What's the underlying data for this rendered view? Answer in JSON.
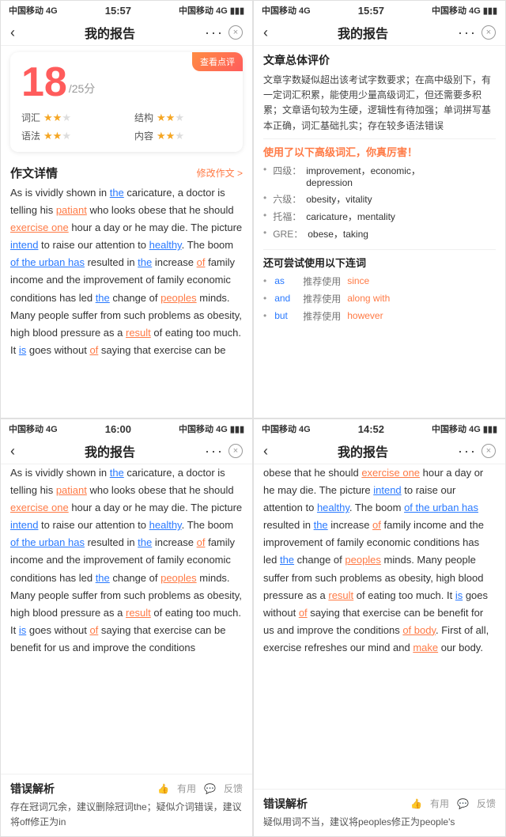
{
  "panels": [
    {
      "id": "panel-top-left",
      "status": {
        "carrier": "中国移动",
        "network": "4G",
        "time": "15:57",
        "carrier2": "中国移动",
        "network2": "4G"
      },
      "nav": {
        "title": "我的报告",
        "back": "<",
        "dots": "...",
        "close": "×"
      },
      "score": {
        "review_btn": "查看点评",
        "number": "18",
        "total": "/25分",
        "dims": [
          {
            "label": "词汇",
            "stars": 2,
            "max": 3
          },
          {
            "label": "结构",
            "stars": 2,
            "max": 3
          },
          {
            "label": "语法",
            "stars": 2,
            "max": 3
          },
          {
            "label": "内容",
            "stars": 2,
            "max": 3
          }
        ]
      },
      "section": {
        "title": "作文详情",
        "action": "修改作文 >"
      },
      "essay_segments": [
        {
          "text": "As is vividly shown in ",
          "type": "normal"
        },
        {
          "text": "the",
          "type": "blue"
        },
        {
          "text": " caricature, a doctor is telling his ",
          "type": "normal"
        },
        {
          "text": "patiant",
          "type": "orange"
        },
        {
          "text": " who looks obese that he should ",
          "type": "normal"
        },
        {
          "text": "exercise one",
          "type": "orange-underline"
        },
        {
          "text": " hour a day or he may die. The picture ",
          "type": "normal"
        },
        {
          "text": "intend",
          "type": "blue"
        },
        {
          "text": " to raise our attention to ",
          "type": "normal"
        },
        {
          "text": "healthy",
          "type": "blue"
        },
        {
          "text": ". The boom ",
          "type": "normal"
        },
        {
          "text": "of the urban has",
          "type": "blue"
        },
        {
          "text": " resulted in ",
          "type": "normal"
        },
        {
          "text": "the",
          "type": "blue"
        },
        {
          "text": " increase ",
          "type": "normal"
        },
        {
          "text": "of",
          "type": "orange"
        },
        {
          "text": " family income and the improvement of family economic conditions has led ",
          "type": "normal"
        },
        {
          "text": "the",
          "type": "blue"
        },
        {
          "text": " change of ",
          "type": "normal"
        },
        {
          "text": "peoples",
          "type": "orange"
        },
        {
          "text": " minds. Many people suffer from such problems as obesity, high blood pressure as a ",
          "type": "normal"
        },
        {
          "text": "result",
          "type": "orange"
        },
        {
          "text": " of eating too much. It ",
          "type": "normal"
        },
        {
          "text": "is",
          "type": "blue"
        },
        {
          "text": " goes without ",
          "type": "normal"
        },
        {
          "text": "of",
          "type": "orange"
        },
        {
          "text": " saying that exercise can be",
          "type": "normal"
        }
      ]
    },
    {
      "id": "panel-top-right",
      "status": {
        "carrier": "中国移动",
        "network": "4G",
        "time": "15:57",
        "carrier2": "中国移动",
        "network2": "4G"
      },
      "nav": {
        "title": "我的报告",
        "back": "<",
        "dots": "...",
        "close": "×"
      },
      "overall": {
        "title": "文章总体评价",
        "text": "文章字数疑似超出该考试字数要求；在高中级别下，有一定词汇积累，能使用少量高级词汇，但还需要多积累；文章语句较为生硬，逻辑性有待加强；单词拼写基本正确，词汇基础扎实；存在较多语法错误"
      },
      "vocab": {
        "title": "使用了以下高级词汇，你真厉害！",
        "items": [
          {
            "level": "四级：",
            "words": "improvement，economic，depression"
          },
          {
            "level": "六级：",
            "words": "obesity，vitality"
          },
          {
            "level": "托福：",
            "words": "caricature，mentality"
          },
          {
            "level": "GRE：",
            "words": "obese，taking"
          }
        ]
      },
      "connectors": {
        "title": "还可尝试使用以下连词",
        "items": [
          {
            "word": "as",
            "label": "推荐使用",
            "suggest": "since"
          },
          {
            "word": "and",
            "label": "推荐使用",
            "suggest": "along with"
          },
          {
            "word": "but",
            "label": "推荐使用",
            "suggest": "however"
          }
        ]
      }
    },
    {
      "id": "panel-bottom-left",
      "status": {
        "carrier": "中国移动",
        "network": "4G",
        "time": "16:00"
      },
      "nav": {
        "title": "我的报告",
        "back": "<",
        "dots": "...",
        "close": "×"
      },
      "essay_segments": [
        {
          "text": "As is vividly shown in ",
          "type": "normal"
        },
        {
          "text": "the",
          "type": "blue"
        },
        {
          "text": " caricature, a doctor is telling his ",
          "type": "normal"
        },
        {
          "text": "patiant",
          "type": "orange"
        },
        {
          "text": " who looks obese that he should ",
          "type": "normal"
        },
        {
          "text": "exercise one",
          "type": "orange-underline"
        },
        {
          "text": " hour a day or he may die. The picture ",
          "type": "normal"
        },
        {
          "text": "intend",
          "type": "blue"
        },
        {
          "text": " to raise our attention to ",
          "type": "normal"
        },
        {
          "text": "healthy",
          "type": "blue"
        },
        {
          "text": ". The boom ",
          "type": "normal"
        },
        {
          "text": "of the urban has",
          "type": "blue"
        },
        {
          "text": " resulted in ",
          "type": "normal"
        },
        {
          "text": "the",
          "type": "blue"
        },
        {
          "text": " increase ",
          "type": "normal"
        },
        {
          "text": "of",
          "type": "orange"
        },
        {
          "text": " family income and the improvement of family economic conditions has led ",
          "type": "normal"
        },
        {
          "text": "the",
          "type": "blue"
        },
        {
          "text": " change of ",
          "type": "normal"
        },
        {
          "text": "peoples",
          "type": "orange"
        },
        {
          "text": " minds. Many people suffer from such problems as obesity, high blood pressure as a ",
          "type": "normal"
        },
        {
          "text": "result",
          "type": "orange"
        },
        {
          "text": " of eating too much. It ",
          "type": "normal"
        },
        {
          "text": "is",
          "type": "blue"
        },
        {
          "text": " goes without ",
          "type": "normal"
        },
        {
          "text": "of",
          "type": "orange"
        },
        {
          "text": " saying that exercise can be benefit for us and improve the conditions",
          "type": "normal"
        }
      ],
      "error": {
        "title": "错误解析",
        "helpful": "有用",
        "feedback": "反馈",
        "text": "存在冠词冗余，建议删除冠词the；疑似介词错误，建议将off修正为in"
      }
    },
    {
      "id": "panel-bottom-right",
      "status": {
        "carrier": "中国移动",
        "network": "4G",
        "time": "14:52"
      },
      "nav": {
        "title": "我的报告",
        "back": "<",
        "dots": "...",
        "close": "×"
      },
      "essay_segments": [
        {
          "text": "obese that he should ",
          "type": "normal"
        },
        {
          "text": "exercise one",
          "type": "orange-underline"
        },
        {
          "text": " hour a day or he may die. The picture ",
          "type": "normal"
        },
        {
          "text": "intend",
          "type": "blue"
        },
        {
          "text": " to raise our attention to ",
          "type": "normal"
        },
        {
          "text": "healthy",
          "type": "blue"
        },
        {
          "text": ". The boom ",
          "type": "normal"
        },
        {
          "text": "of the urban has",
          "type": "blue"
        },
        {
          "text": " resulted in ",
          "type": "normal"
        },
        {
          "text": "the",
          "type": "blue"
        },
        {
          "text": " increase ",
          "type": "normal"
        },
        {
          "text": "of",
          "type": "orange"
        },
        {
          "text": " family income and the improvement of family economic conditions has led ",
          "type": "normal"
        },
        {
          "text": "the",
          "type": "blue"
        },
        {
          "text": " change of ",
          "type": "normal"
        },
        {
          "text": "peoples",
          "type": "orange"
        },
        {
          "text": " minds. Many people suffer from such problems as obesity, high blood pressure as a ",
          "type": "normal"
        },
        {
          "text": "result",
          "type": "orange"
        },
        {
          "text": " of eating too much. It ",
          "type": "normal"
        },
        {
          "text": "is",
          "type": "blue"
        },
        {
          "text": " goes without ",
          "type": "normal"
        },
        {
          "text": "of",
          "type": "orange"
        },
        {
          "text": " saying that exercise can be benefit for us and improve the conditions ",
          "type": "normal"
        },
        {
          "text": "of body",
          "type": "orange"
        },
        {
          "text": ". First of all, exercise refreshes our mind and ",
          "type": "normal"
        },
        {
          "text": "make",
          "type": "orange"
        },
        {
          "text": " our body.",
          "type": "normal"
        }
      ],
      "error": {
        "title": "错误解析",
        "helpful": "有用",
        "feedback": "反馈",
        "text": "疑似用词不当，建议将peoples修正为people's"
      }
    }
  ]
}
